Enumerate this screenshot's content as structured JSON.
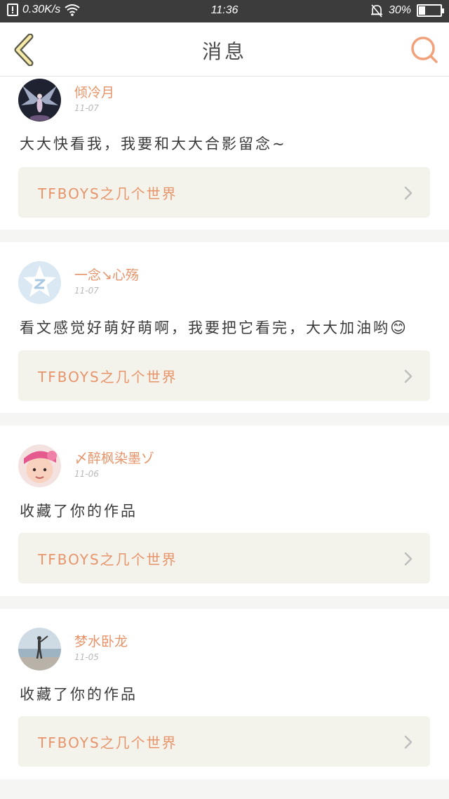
{
  "status_bar": {
    "net_speed": "0.30K/s",
    "time": "11:36",
    "battery": "30%",
    "battery_level": 0.3
  },
  "nav": {
    "title": "消息",
    "back_icon": "chevron-left-icon",
    "search_icon": "search-icon"
  },
  "colors": {
    "accent": "#e8946a",
    "back_fill": "#f7e9a8",
    "status_bar": "#3c3c3c"
  },
  "messages": [
    {
      "name": "倾冷月",
      "date": "11-07",
      "text": "大大快看我，我要和大大合影留念~",
      "work_title": "TFBOYS之几个世界",
      "avatar": "angel-wings-avatar"
    },
    {
      "name": "一念↘心殇",
      "date": "11-07",
      "text": "看文感觉好萌好萌啊，我要把它看完，大大加油哟",
      "emoji": "😊",
      "work_title": "TFBOYS之几个世界",
      "avatar": "default-qq-avatar"
    },
    {
      "name": "〆醉枫染墨ゾ",
      "date": "11-06",
      "text": "收藏了你的作品",
      "work_title": "TFBOYS之几个世界",
      "avatar": "child-photo-avatar"
    },
    {
      "name": "梦水卧龙",
      "date": "11-05",
      "text": "收藏了你的作品",
      "work_title": "TFBOYS之几个世界",
      "avatar": "beach-photo-avatar"
    }
  ]
}
